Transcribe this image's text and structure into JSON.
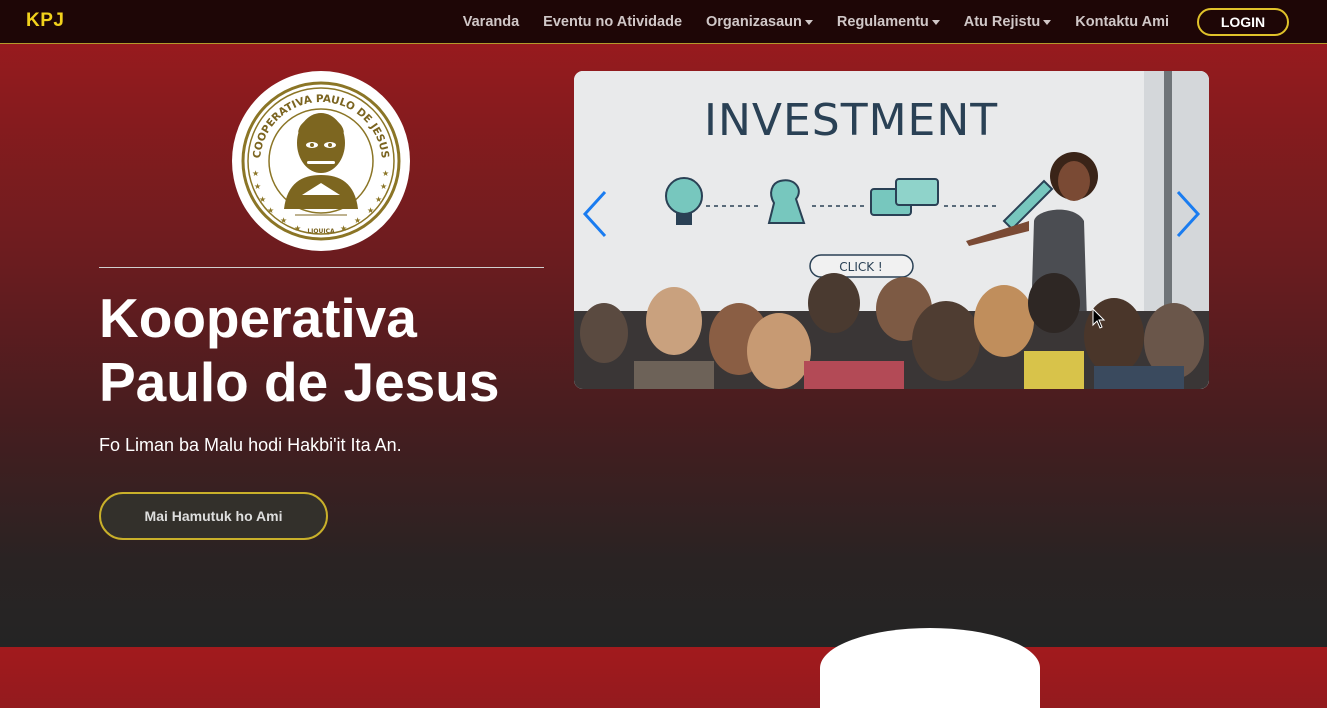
{
  "nav": {
    "brand": "KPJ",
    "items": [
      {
        "label": "Varanda",
        "dropdown": false
      },
      {
        "label": "Eventu no Atividade",
        "dropdown": false
      },
      {
        "label": "Organizasaun",
        "dropdown": true
      },
      {
        "label": "Regulamentu",
        "dropdown": true
      },
      {
        "label": "Atu Rejistu",
        "dropdown": true
      },
      {
        "label": "Kontaktu Ami",
        "dropdown": false
      }
    ],
    "login": "LOGIN"
  },
  "logo": {
    "ring_text": "COOPERATIVA PAULO DE JESUS",
    "bottom_text": "LIQUIÇA"
  },
  "hero": {
    "title_line1": "Kooperativa",
    "title_line2": "Paulo de Jesus",
    "subtitle": "Fo Liman ba Malu hodi Hakbi'it Ita An.",
    "cta": "Mai Hamutuk ho Ami"
  },
  "carousel": {
    "headline": "INVESTMENT",
    "button_text": "CLICK !"
  },
  "colors": {
    "brand_yellow": "#f1d11c",
    "accent_gold": "#e0c22a",
    "bg_red": "#a21a1d",
    "bg_dark": "#242424",
    "carousel_arrow": "#1a7cf0"
  }
}
